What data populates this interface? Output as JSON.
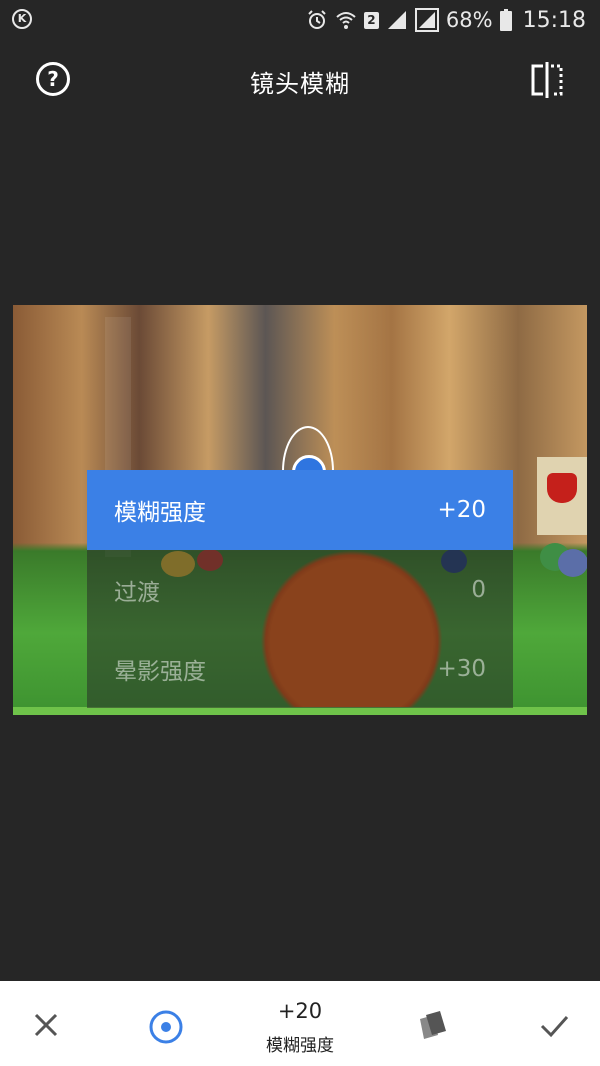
{
  "status_bar": {
    "sim_slot": "2",
    "battery_percent": "68%",
    "time": "15:18"
  },
  "header": {
    "title": "镜头模糊"
  },
  "parameters": [
    {
      "label": "模糊强度",
      "value": "+20",
      "selected": true
    },
    {
      "label": "过渡",
      "value": "0",
      "selected": false
    },
    {
      "label": "晕影强度",
      "value": "+30",
      "selected": false
    }
  ],
  "bottom_bar": {
    "value": "+20",
    "label": "模糊强度"
  },
  "colors": {
    "accent": "#3b80e6",
    "background": "#262626",
    "bottom_bar": "#ffffff"
  },
  "icons": [
    "k-icon",
    "alarm-icon",
    "wifi-icon",
    "signal-icon",
    "battery-icon",
    "help-icon",
    "compare-icon",
    "close-icon",
    "focus-target-icon",
    "styles-icon",
    "check-icon"
  ]
}
